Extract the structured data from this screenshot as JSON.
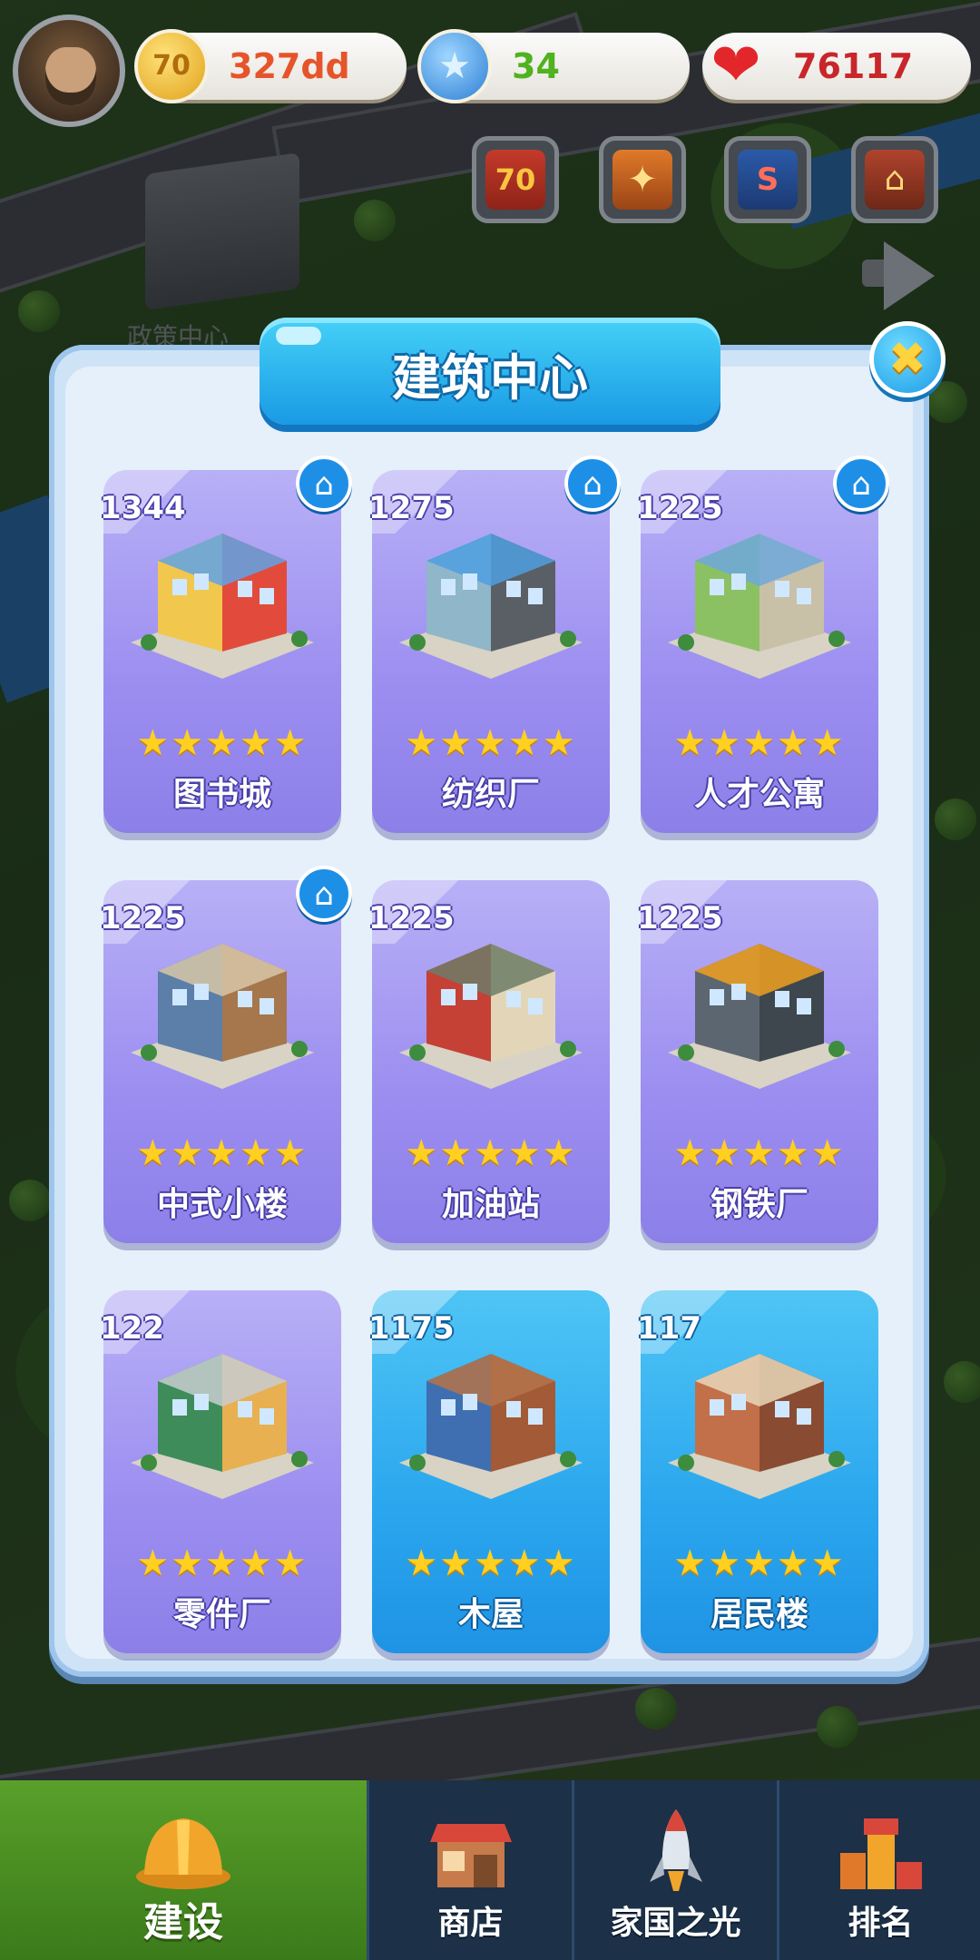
{
  "resources": {
    "gold": {
      "icon": "gold-coin-icon",
      "coin_text": "70",
      "value": "327dd"
    },
    "star": {
      "icon": "star-coin-icon",
      "coin_text": "★",
      "value": "34"
    },
    "heart": {
      "icon": "heart-icon",
      "coin_text": "❤",
      "value": "76117"
    }
  },
  "quick_buttons": [
    {
      "icon": "seventy-event-icon",
      "glyph": "70"
    },
    {
      "icon": "handshake-icon",
      "glyph": "✦"
    },
    {
      "icon": "fire-safety-icon",
      "glyph": "S"
    },
    {
      "icon": "pavilion-icon",
      "glyph": "⌂"
    }
  ],
  "background": {
    "policy_label": "政策中心"
  },
  "dialog": {
    "title": "建筑中心",
    "close_glyph": "✖"
  },
  "buildings": [
    {
      "number": "1344",
      "name": "图书城",
      "stars": "★★★★★",
      "has_home": true,
      "style": "purple"
    },
    {
      "number": "1275",
      "name": "纺织厂",
      "stars": "★★★★★",
      "has_home": true,
      "style": "purple"
    },
    {
      "number": "1225",
      "name": "人才公寓",
      "stars": "★★★★★",
      "has_home": true,
      "style": "purple"
    },
    {
      "number": "1225",
      "name": "中式小楼",
      "stars": "★★★★★",
      "has_home": true,
      "style": "purple"
    },
    {
      "number": "1225",
      "name": "加油站",
      "stars": "★★★★★",
      "has_home": false,
      "style": "purple"
    },
    {
      "number": "1225",
      "name": "钢铁厂",
      "stars": "★★★★★",
      "has_home": false,
      "style": "purple"
    },
    {
      "number": "122",
      "name": "零件厂",
      "stars": "★★★★★",
      "has_home": false,
      "style": "purple"
    },
    {
      "number": "1175",
      "name": "木屋",
      "stars": "★★★★★",
      "has_home": false,
      "style": "blue"
    },
    {
      "number": "117",
      "name": "居民楼",
      "stars": "★★★★★",
      "has_home": false,
      "style": "blue"
    }
  ],
  "home_glyph": "⌂",
  "nav": [
    {
      "label": "建设",
      "icon": "hard-hat-icon",
      "active": true
    },
    {
      "label": "商店",
      "icon": "shop-icon",
      "active": false
    },
    {
      "label": "家国之光",
      "icon": "rocket-icon",
      "active": false
    },
    {
      "label": "排名",
      "icon": "ranking-icon",
      "active": false
    }
  ],
  "colors": {
    "card_purple": "#9b8df0",
    "card_blue": "#2aa6ee",
    "title_blue": "#1a9ae4",
    "star_yellow": "#ffd020",
    "nav_active_green": "#3b7a1a"
  }
}
